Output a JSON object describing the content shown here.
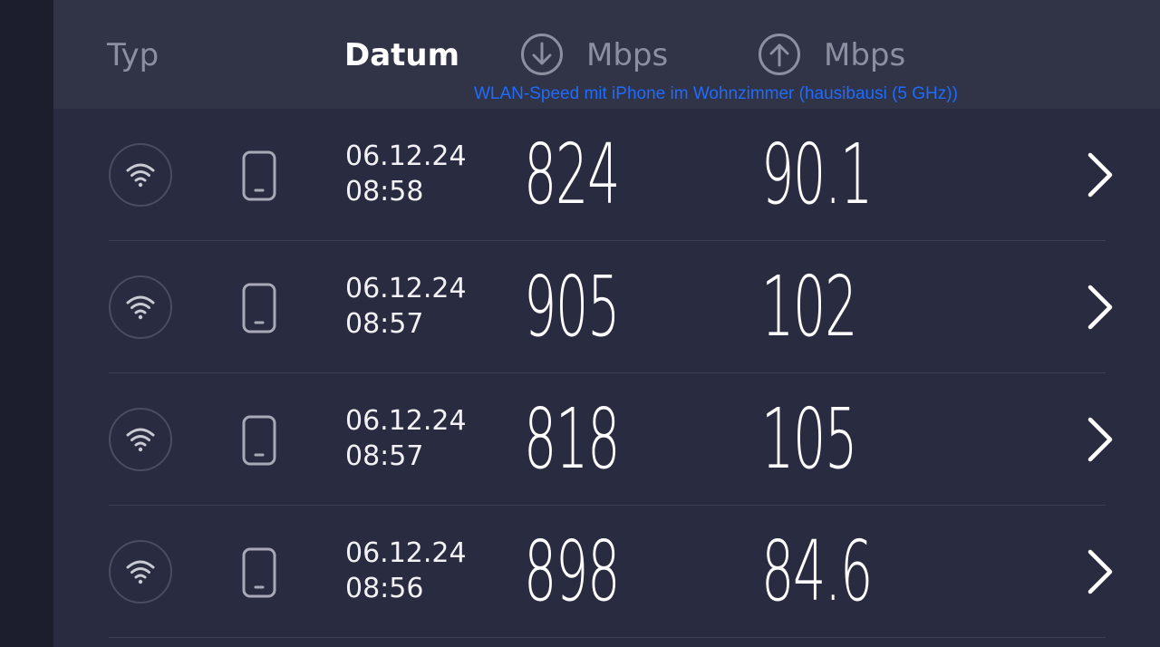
{
  "header": {
    "typ_label": "Typ",
    "datum_label": "Datum",
    "download_icon": "arrow-down-circle-icon",
    "download_unit": "Mbps",
    "upload_icon": "arrow-up-circle-icon",
    "upload_unit": "Mbps"
  },
  "caption": "WLAN-Speed mit iPhone im Wohnzimmer (hausibausi (5 GHz))",
  "rows": [
    {
      "type_icon": "wifi-icon",
      "device_icon": "phone-icon",
      "date": "06.12.24",
      "time": "08:58",
      "download": "824",
      "upload": "90.1"
    },
    {
      "type_icon": "wifi-icon",
      "device_icon": "phone-icon",
      "date": "06.12.24",
      "time": "08:57",
      "download": "905",
      "upload": "102"
    },
    {
      "type_icon": "wifi-icon",
      "device_icon": "phone-icon",
      "date": "06.12.24",
      "time": "08:57",
      "download": "818",
      "upload": "105"
    },
    {
      "type_icon": "wifi-icon",
      "device_icon": "phone-icon",
      "date": "06.12.24",
      "time": "08:56",
      "download": "898",
      "upload": "84.6"
    }
  ],
  "colors": {
    "background": "#292b40",
    "header_background": "#313346",
    "caption": "#1e6cff",
    "muted_text": "#8c8fa0"
  }
}
